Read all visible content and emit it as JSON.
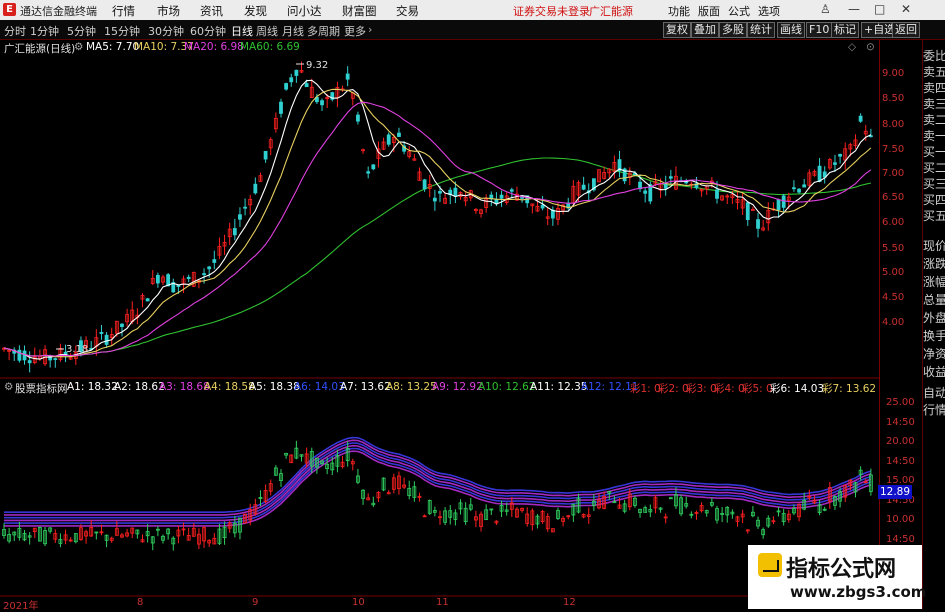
{
  "app": {
    "title": "通达信金融终端"
  },
  "menu": [
    "行情",
    "市场",
    "资讯",
    "发现",
    "问小达",
    "财富圈",
    "交易"
  ],
  "menu_warning": [
    "证券交易未登录",
    "广汇能源"
  ],
  "menu_right": [
    "功能",
    "版面",
    "公式",
    "选项"
  ],
  "period_tabs": [
    "分时",
    "1分钟",
    "5分钟",
    "15分钟",
    "30分钟",
    "60分钟",
    "日线",
    "周线",
    "月线",
    "多周期",
    "更多"
  ],
  "toolbar_right": [
    "复权",
    "叠加",
    "多股",
    "统计",
    "画线",
    "F10",
    "标记",
    "+自选",
    "返回"
  ],
  "main_chart": {
    "header_name": "广汇能源(日线)",
    "ma": [
      {
        "label": "MA5: 7.70",
        "color": "#ffffff"
      },
      {
        "label": "MA10: 7.37",
        "color": "#e8d060"
      },
      {
        "label": "MA20: 6.98",
        "color": "#e040e0"
      },
      {
        "label": "MA60: 6.69",
        "color": "#30c030"
      }
    ],
    "axis_ticks": [
      "9.00",
      "8.50",
      "8.00",
      "7.50",
      "7.00",
      "6.50",
      "6.00",
      "5.50",
      "5.00",
      "4.50",
      "4.00"
    ],
    "high_label": "9.32",
    "low_label": "3.18"
  },
  "sub_chart": {
    "header_name": "股票指标网",
    "params": [
      {
        "label": "A1: 18.32",
        "color": "#ffffff"
      },
      {
        "label": "A2: 18.62",
        "color": "#ffffff"
      },
      {
        "label": "A3: 18.68",
        "color": "#e040e0"
      },
      {
        "label": "A4: 18.58",
        "color": "#e8d060"
      },
      {
        "label": "A5: 18.38",
        "color": "#ffffff"
      },
      {
        "label": "A6: 14.03",
        "color": "#3050ff"
      },
      {
        "label": "A7: 13.62",
        "color": "#ffffff"
      },
      {
        "label": "A8: 13.25",
        "color": "#e8d060"
      },
      {
        "label": "A9: 12.92",
        "color": "#e040e0"
      },
      {
        "label": "A10: 12.62",
        "color": "#30c030"
      },
      {
        "label": "A11: 12.35",
        "color": "#ffffff"
      },
      {
        "label": "A12: 12.11",
        "color": "#3050ff"
      },
      {
        "label": "彩1: 0",
        "color": "#e03030"
      },
      {
        "label": "彩2: 0",
        "color": "#e03030"
      },
      {
        "label": "彩3: 0",
        "color": "#e03030"
      },
      {
        "label": "彩4: 0",
        "color": "#e03030"
      },
      {
        "label": "彩5: 0",
        "color": "#e03030"
      },
      {
        "label": "彩6: 14.03",
        "color": "#ffffff"
      },
      {
        "label": "彩7: 13.62",
        "color": "#e8d060"
      }
    ],
    "axis_ticks": [
      "25.00",
      "14:50",
      "20.00",
      "14:50",
      "15.00",
      "14:50",
      "10.00",
      "14:50"
    ],
    "last_value": "12.89"
  },
  "x_labels": [
    "2021年",
    "8",
    "9",
    "10",
    "11",
    "12"
  ],
  "right_panel": {
    "items": [
      "委比",
      "卖五",
      "卖四",
      "卖三",
      "卖二",
      "卖一",
      "买一",
      "买二",
      "买三",
      "买四",
      "买五",
      "现价",
      "涨跌",
      "涨幅",
      "总量",
      "外盘",
      "换手",
      "净资",
      "收益"
    ],
    "lower_items": [
      "自动",
      "行情"
    ]
  },
  "watermark": {
    "line1": "指标公式网",
    "line2": "www.zbgs3.com"
  },
  "colors": {
    "up": "#ff2020",
    "down": "#30d0d0",
    "ma5": "#ffffff",
    "ma10": "#e8d060",
    "ma20": "#e040e0",
    "ma60": "#30c030",
    "axis": "#c83030"
  }
}
